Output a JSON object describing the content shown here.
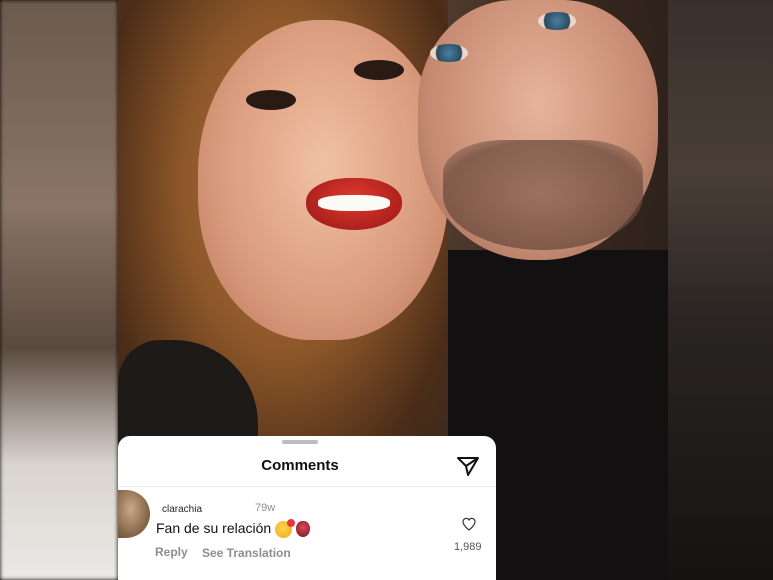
{
  "comments_sheet": {
    "title": "Comments",
    "send_icon": "paper-plane-icon"
  },
  "comment": {
    "username": "clarachia",
    "time": "79w",
    "text": "Fan de su relación",
    "emojis": [
      "smiling-face-with-hearts-icon",
      "anatomical-heart-icon"
    ],
    "reply_label": "Reply",
    "translation_label": "See Translation",
    "like_icon": "heart-outline-icon",
    "like_count": "1,989"
  },
  "colors": {
    "sheet_bg": "#ffffff",
    "secondary_text": "#8e8e8e",
    "primary_text": "#111111"
  }
}
